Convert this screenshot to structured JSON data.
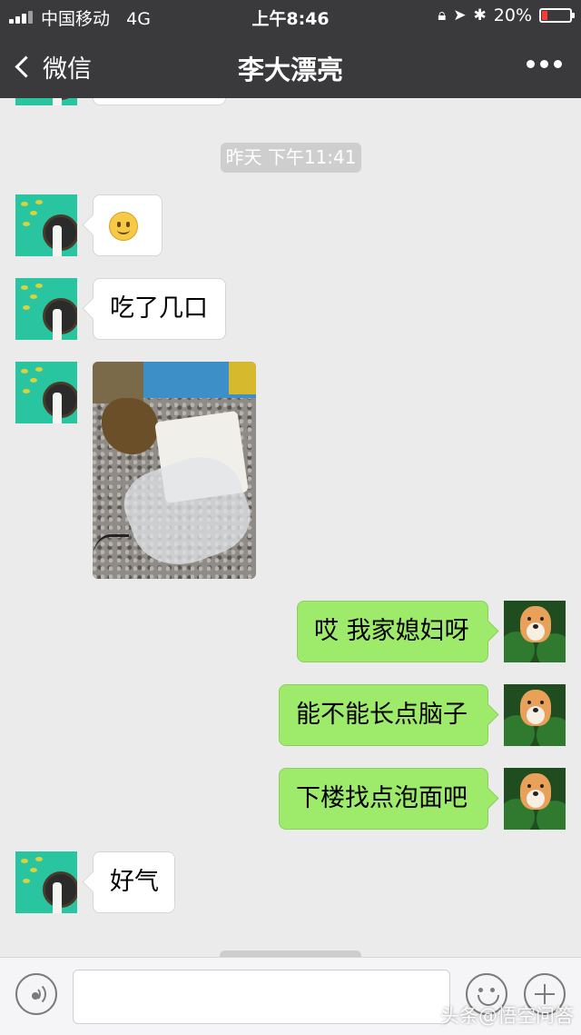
{
  "status_bar": {
    "carrier": "中国移动",
    "network": "4G",
    "time": "上午8:46",
    "battery": "20%",
    "battery_level": 0.2,
    "icons": [
      "rotation-lock-icon",
      "location-icon",
      "bluetooth-icon"
    ]
  },
  "nav": {
    "back_label": "微信",
    "title": "李大漂亮",
    "more_icon": "more-icon"
  },
  "chat": {
    "timestamp": "昨天 下午11:41",
    "messages": [
      {
        "from": "other",
        "type": "emoji",
        "icon": "smiley-emoji-icon"
      },
      {
        "from": "other",
        "type": "text",
        "text": "吃了几口"
      },
      {
        "from": "other",
        "type": "image",
        "icon": "photo-thumbnail"
      },
      {
        "from": "me",
        "type": "text",
        "text": "哎 我家媳妇呀"
      },
      {
        "from": "me",
        "type": "text",
        "text": "能不能长点脑子"
      },
      {
        "from": "me",
        "type": "text",
        "text": "下楼找点泡面吧"
      },
      {
        "from": "other",
        "type": "text",
        "text": "好气"
      }
    ]
  },
  "input_bar": {
    "text": "",
    "icons": [
      "voice-icon",
      "emoji-icon",
      "plus-icon"
    ]
  },
  "watermark": "头条@悟空问答",
  "colors": {
    "header_bg": "#3a3a3c",
    "chat_bg": "#ebebeb",
    "outgoing_bubble": "#9eea6a",
    "incoming_bubble": "#ffffff",
    "battery_low": "#ff3b30"
  }
}
